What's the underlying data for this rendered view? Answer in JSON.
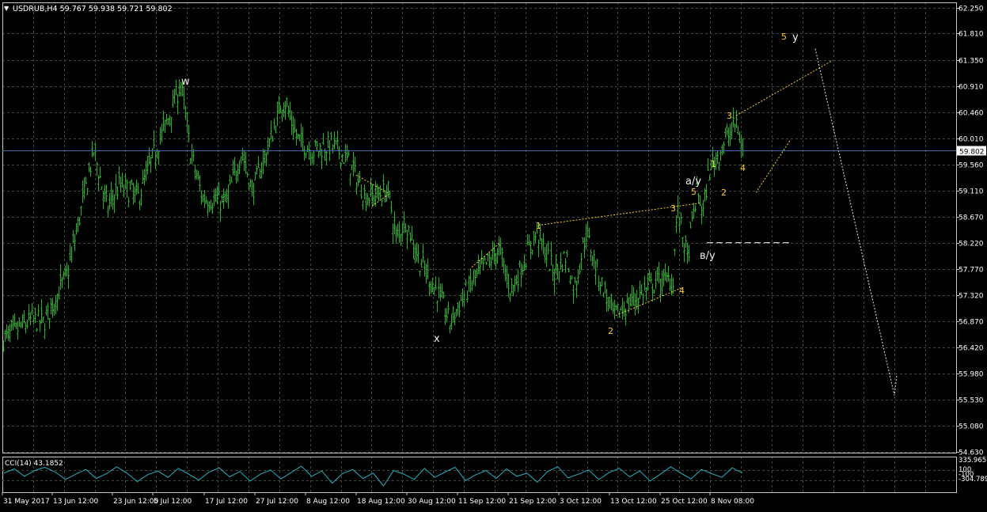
{
  "header": {
    "collapse_glyph": "▼",
    "symbol_info": "USDRUB,H4  59.767 59.938 59.721 59.802"
  },
  "colors": {
    "background": "#000000",
    "grid": "#3a4a3a",
    "frame": "#c8c8c8",
    "candles": "#22b422",
    "wave_labels_primary": "#f0f0f0",
    "wave_labels_minor": "#ffd21a",
    "trendlines": "#ffd21a",
    "projection": "#e8e8e8",
    "current_price_line": "#3a6ea5",
    "price_tag_bg": "#ffffff",
    "price_tag_text": "#000000",
    "cci_line": "#20b2c0"
  },
  "chart_data": [
    {
      "type": "candlestick",
      "symbol": "USDRUB",
      "timeframe": "H4",
      "ohlc_last": {
        "open": 59.767,
        "high": 59.938,
        "low": 59.721,
        "close": 59.802
      },
      "current_price_label": "59.802",
      "ylim": [
        54.63,
        62.25
      ],
      "y_tick_labels": [
        "62.250",
        "61.810",
        "61.350",
        "60.910",
        "60.460",
        "60.010",
        "59.560",
        "59.110",
        "58.670",
        "58.220",
        "57.770",
        "57.320",
        "56.870",
        "56.420",
        "55.980",
        "55.530",
        "55.080",
        "54.630"
      ],
      "x_tick_labels": [
        "31 May 2017",
        "13 Jun 12:00",
        "23 Jun 12:00",
        "5 Jul 12:00",
        "17 Jul 12:00",
        "27 Jul 12:00",
        "8 Aug 12:00",
        "18 Aug 12:00",
        "30 Aug 12:00",
        "11 Sep 12:00",
        "21 Sep 12:00",
        "3 Oct 12:00",
        "13 Oct 12:00",
        "25 Oct 12:00",
        "8 Nov 08:00"
      ],
      "grid": true,
      "price_path_knots": [
        {
          "x": "31 May 2017",
          "y": 56.55
        },
        {
          "x": "~7 Jun",
          "y": 56.9
        },
        {
          "x": "~9 Jun",
          "y": 56.85
        },
        {
          "x": "13 Jun 12:00",
          "y": 57.7
        },
        {
          "x": "~17 Jun",
          "y": 59.8
        },
        {
          "x": "~20 Jun",
          "y": 58.8
        },
        {
          "x": "23 Jun 12:00",
          "y": 59.2
        },
        {
          "x": "~28 Jun",
          "y": 59.0
        },
        {
          "x": "~30 Jun",
          "y": 59.6
        },
        {
          "x": "5 Jul 12:00",
          "y": 60.35
        },
        {
          "x": "~7 Jul",
          "y": 60.95
        },
        {
          "x": "~10 Jul",
          "y": 59.8
        },
        {
          "x": "~13 Jul",
          "y": 59.0
        },
        {
          "x": "17 Jul 12:00",
          "y": 58.9
        },
        {
          "x": "~21 Jul",
          "y": 59.8
        },
        {
          "x": "~24 Jul",
          "y": 59.1
        },
        {
          "x": "27 Jul 12:00",
          "y": 59.8
        },
        {
          "x": "~29 Jul",
          "y": 60.7
        },
        {
          "x": "~1 Aug",
          "y": 60.0
        },
        {
          "x": "~4 Aug",
          "y": 59.8
        },
        {
          "x": "8 Aug 12:00",
          "y": 59.9
        },
        {
          "x": "~11 Aug",
          "y": 59.6
        },
        {
          "x": "~14 Aug",
          "y": 59.0
        },
        {
          "x": "18 Aug 12:00",
          "y": 59.1
        },
        {
          "x": "~21 Aug",
          "y": 58.3
        },
        {
          "x": "~23 Aug",
          "y": 58.6
        },
        {
          "x": "~26 Aug",
          "y": 57.9
        },
        {
          "x": "30 Aug 12:00",
          "y": 57.3
        },
        {
          "x": "~2 Sep",
          "y": 56.85
        },
        {
          "x": "~6 Sep",
          "y": 57.3
        },
        {
          "x": "11 Sep 12:00",
          "y": 57.7
        },
        {
          "x": "~14 Sep",
          "y": 58.1
        },
        {
          "x": "~17 Sep",
          "y": 57.4
        },
        {
          "x": "21 Sep 12:00",
          "y": 58.4
        },
        {
          "x": "~25 Sep",
          "y": 57.7
        },
        {
          "x": "~28 Sep",
          "y": 58.0
        },
        {
          "x": "3 Oct 12:00",
          "y": 57.4
        },
        {
          "x": "~6 Oct",
          "y": 58.4
        },
        {
          "x": "~9 Oct",
          "y": 57.7
        },
        {
          "x": "13 Oct 12:00",
          "y": 56.95
        },
        {
          "x": "~17 Oct",
          "y": 57.3
        },
        {
          "x": "~21 Oct",
          "y": 57.55
        },
        {
          "x": "25 Oct 12:00",
          "y": 57.6
        },
        {
          "x": "~27 Oct",
          "y": 58.8
        },
        {
          "x": "~29 Oct",
          "y": 57.95
        },
        {
          "x": "~1 Nov",
          "y": 59.1
        },
        {
          "x": "~3 Nov",
          "y": 58.75
        },
        {
          "x": "~5 Nov",
          "y": 59.45
        },
        {
          "x": "8 Nov 08:00",
          "y": 60.3
        },
        {
          "x": "~9 Nov",
          "y": 59.8
        }
      ],
      "annotations": [
        {
          "text": "w",
          "color": "primary"
        },
        {
          "text": "x",
          "color": "primary"
        },
        {
          "text": "a/y",
          "color": "primary"
        },
        {
          "text": "в/y",
          "color": "primary"
        },
        {
          "text": "y",
          "color": "primary"
        },
        {
          "text": "1",
          "color": "minor"
        },
        {
          "text": "2",
          "color": "minor"
        },
        {
          "text": "3",
          "color": "minor"
        },
        {
          "text": "4",
          "color": "minor"
        },
        {
          "text": "5",
          "color": "minor"
        },
        {
          "text": "1",
          "color": "minor"
        },
        {
          "text": "2",
          "color": "minor"
        },
        {
          "text": "3",
          "color": "minor"
        },
        {
          "text": "4",
          "color": "minor"
        },
        {
          "text": "5",
          "color": "minor"
        }
      ]
    },
    {
      "type": "line",
      "indicator": "CCI(14)",
      "title": "CCI(14) 43.1852",
      "y_tick_labels": [
        "335.9657",
        "100",
        "-100",
        "-304.7894"
      ],
      "ylim": [
        -304.7894,
        335.9657
      ],
      "values": [
        40,
        120,
        -20,
        90,
        150,
        60,
        -80,
        20,
        110,
        -60,
        30,
        160,
        40,
        -120,
        10,
        80,
        -40,
        130,
        20,
        -90,
        60,
        140,
        -30,
        70,
        -110,
        20,
        100,
        -70,
        50,
        170,
        -20,
        80,
        -150,
        30,
        110,
        -60,
        40,
        -200,
        90,
        20,
        -80,
        130,
        -40,
        60,
        150,
        -100,
        10,
        90,
        -60,
        120,
        -20,
        40,
        -130,
        70,
        160,
        -50,
        20,
        100,
        -80,
        50,
        130,
        -30,
        80,
        -110,
        20,
        160,
        40,
        -70,
        110,
        30,
        -40,
        140,
        43
      ]
    }
  ]
}
